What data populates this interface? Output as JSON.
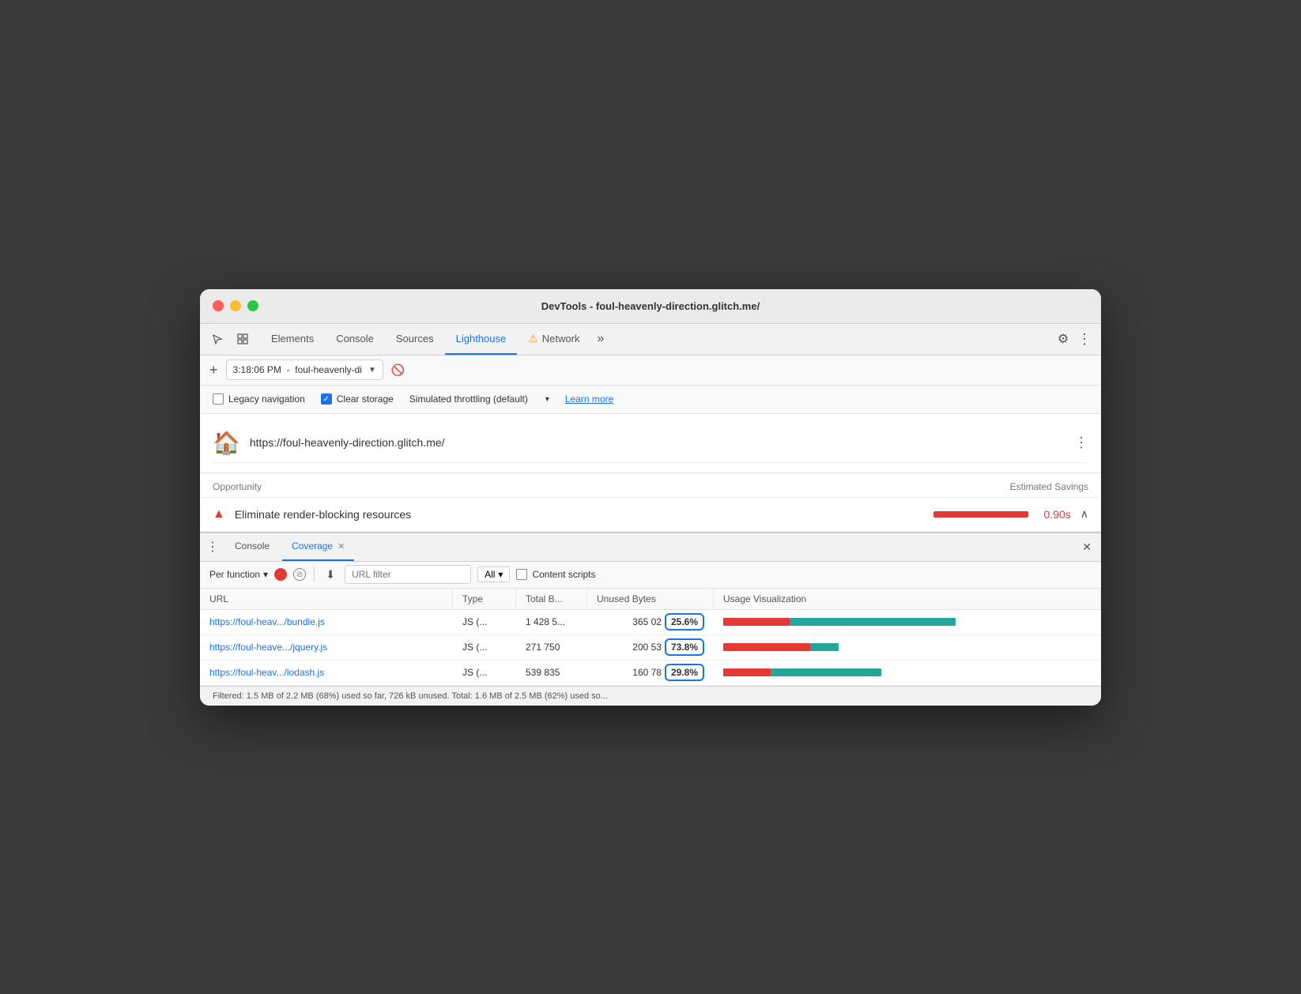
{
  "window": {
    "title": "DevTools - foul-heavenly-direction.glitch.me/"
  },
  "tabs": [
    {
      "id": "elements",
      "label": "Elements",
      "active": false
    },
    {
      "id": "console",
      "label": "Console",
      "active": false
    },
    {
      "id": "sources",
      "label": "Sources",
      "active": false
    },
    {
      "id": "lighthouse",
      "label": "Lighthouse",
      "active": true
    },
    {
      "id": "network",
      "label": "Network",
      "active": false,
      "warning": true
    }
  ],
  "toolbar": {
    "time": "3:18:06 PM",
    "address": "foul-heavenly-di",
    "address_dropdown_symbol": "▼",
    "block_symbol": "⊘"
  },
  "options": {
    "legacy_nav_label": "Legacy navigation",
    "clear_storage_label": "Clear storage",
    "throttle_label": "Simulated throttling (default)",
    "learn_more_label": "Learn more"
  },
  "lighthouse": {
    "url": "https://foul-heavenly-direction.glitch.me/"
  },
  "opportunities": {
    "header_left": "Opportunity",
    "header_right": "Estimated Savings",
    "items": [
      {
        "id": "render-blocking",
        "label": "Eliminate render-blocking resources",
        "savings": "0.90s"
      }
    ]
  },
  "coverage_panel": {
    "tabs": [
      {
        "id": "console",
        "label": "Console",
        "active": false,
        "closeable": false
      },
      {
        "id": "coverage",
        "label": "Coverage",
        "active": true,
        "closeable": true
      }
    ],
    "toolbar": {
      "per_function_label": "Per function",
      "url_filter_placeholder": "URL filter",
      "all_label": "All",
      "content_scripts_label": "Content scripts"
    },
    "table": {
      "columns": [
        "URL",
        "Type",
        "Total B...",
        "Unused Bytes",
        "Usage Visualization"
      ],
      "rows": [
        {
          "url": "https://foul-heav.../bundle.js",
          "type": "JS (...",
          "total": "1 428 5...",
          "unused_raw": "365 02",
          "unused_pct": "25.6%",
          "unused_pct_highlight": true,
          "viz_red_pct": 28,
          "viz_teal_pct": 72
        },
        {
          "url": "https://foul-heave.../jquery.js",
          "type": "JS (...",
          "total": "271 750",
          "unused_raw": "200 53",
          "unused_pct": "73.8%",
          "unused_pct_highlight": true,
          "viz_red_pct": 75,
          "viz_teal_pct": 25
        },
        {
          "url": "https://foul-heav.../lodash.js",
          "type": "JS (...",
          "total": "539 835",
          "unused_raw": "160 78",
          "unused_pct": "29.8%",
          "unused_pct_highlight": true,
          "viz_red_pct": 30,
          "viz_teal_pct": 70
        }
      ]
    },
    "status_bar": "Filtered: 1.5 MB of 2.2 MB (68%) used so far, 726 kB unused. Total: 1.6 MB of 2.5 MB (62%) used so..."
  },
  "icons": {
    "cursor": "⬆",
    "more": "»",
    "settings": "⚙",
    "menu_dots": "⋮",
    "close": "✕",
    "check": "✓",
    "three_dots": "⋮",
    "down_arrow": "▾",
    "block": "🚫"
  }
}
